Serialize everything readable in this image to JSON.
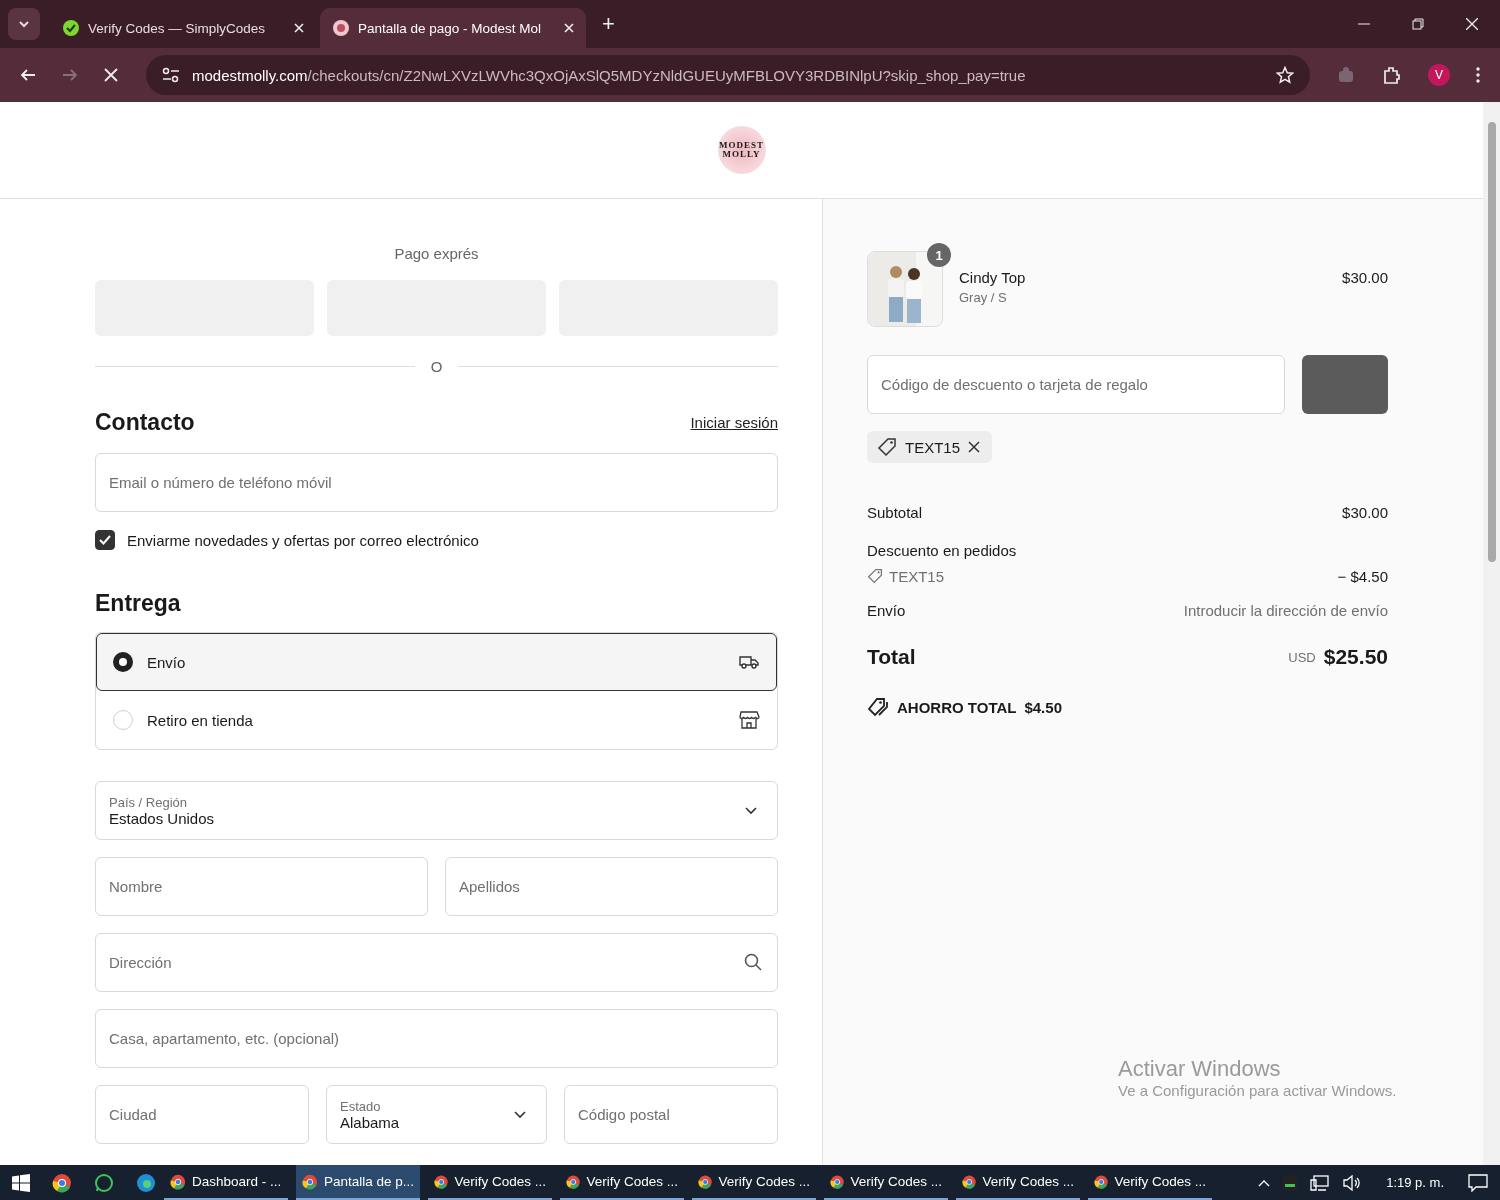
{
  "browser": {
    "tabs": [
      {
        "title": "Verify Codes — SimplyCodes",
        "selected": false,
        "kind": "simply"
      },
      {
        "title": "Pantalla de pago - Modest Mol",
        "selected": true,
        "kind": "shop"
      }
    ],
    "new_tab": "+",
    "url_host": "modestmolly.com",
    "url_path": "/checkouts/cn/Z2NwLXVzLWVhc3QxOjAxSlQ5MDYzNldGUEUyMFBLOVY3RDBINlpU?skip_shop_pay=true",
    "profile": "V"
  },
  "logo": {
    "line_1": "MODEST",
    "line_2": "MOLLY"
  },
  "express": {
    "title": "Pago exprés",
    "divider": "O"
  },
  "contact": {
    "heading": "Contacto",
    "login_link": "Iniciar sesión",
    "field": {
      "placeholder": "Email o número de teléfono móvil"
    },
    "newsletter": {
      "label": "Enviarme novedades y ofertas por correo electrónico",
      "checked": true
    }
  },
  "delivery": {
    "heading": "Entrega",
    "options": [
      {
        "label": "Envío",
        "selected": true,
        "kind": "ship"
      },
      {
        "label": "Retiro en tienda",
        "selected": false,
        "kind": "store"
      }
    ]
  },
  "address_rows": [
    [
      {
        "kind": "select",
        "label": "País / Región",
        "value": "Estados Unidos"
      }
    ],
    [
      {
        "kind": "text",
        "placeholder": "Nombre"
      },
      {
        "kind": "text",
        "placeholder": "Apellidos"
      }
    ],
    [
      {
        "kind": "search",
        "placeholder": "Dirección"
      }
    ],
    [
      {
        "kind": "text",
        "placeholder": "Casa, apartamento, etc. (opcional)"
      }
    ],
    [
      {
        "kind": "text",
        "placeholder": "Ciudad"
      },
      {
        "kind": "select",
        "label": "Estado",
        "value": "Alabama"
      },
      {
        "kind": "text",
        "placeholder": "Código postal"
      }
    ]
  ],
  "summary": {
    "item": {
      "quantity": "1",
      "name": "Cindy Top",
      "variant": "Gray / S",
      "price": "$30.00"
    },
    "discount_field": {
      "placeholder": "Código de descuento o tarjeta de regalo"
    },
    "applied_code": "TEXT15",
    "subtotal": {
      "label": "Subtotal",
      "value": "$30.00"
    },
    "discount": {
      "label": "Descuento en pedidos",
      "code": "TEXT15",
      "value": "− $4.50"
    },
    "shipping": {
      "label": "Envío",
      "value": "Introducir la dirección de envío"
    },
    "total": {
      "label": "Total",
      "currency": "USD",
      "value": "$25.50"
    },
    "savings": {
      "label": "AHORRO TOTAL",
      "value": "$4.50"
    }
  },
  "windows_notice": {
    "title": "Activar Windows",
    "text": "Ve a Configuración para activar Windows."
  },
  "taskbar": {
    "apps": [
      {
        "label": "Dashboard - ...",
        "selected": false
      },
      {
        "label": "Pantalla de p...",
        "selected": true
      },
      {
        "label": "Verify Codes ...",
        "selected": false
      },
      {
        "label": "Verify Codes ...",
        "selected": false
      },
      {
        "label": "Verify Codes ...",
        "selected": false
      },
      {
        "label": "Verify Codes ...",
        "selected": false
      },
      {
        "label": "Verify Codes ...",
        "selected": false
      },
      {
        "label": "Verify Codes ...",
        "selected": false
      }
    ],
    "time": "1:19 p. m."
  }
}
